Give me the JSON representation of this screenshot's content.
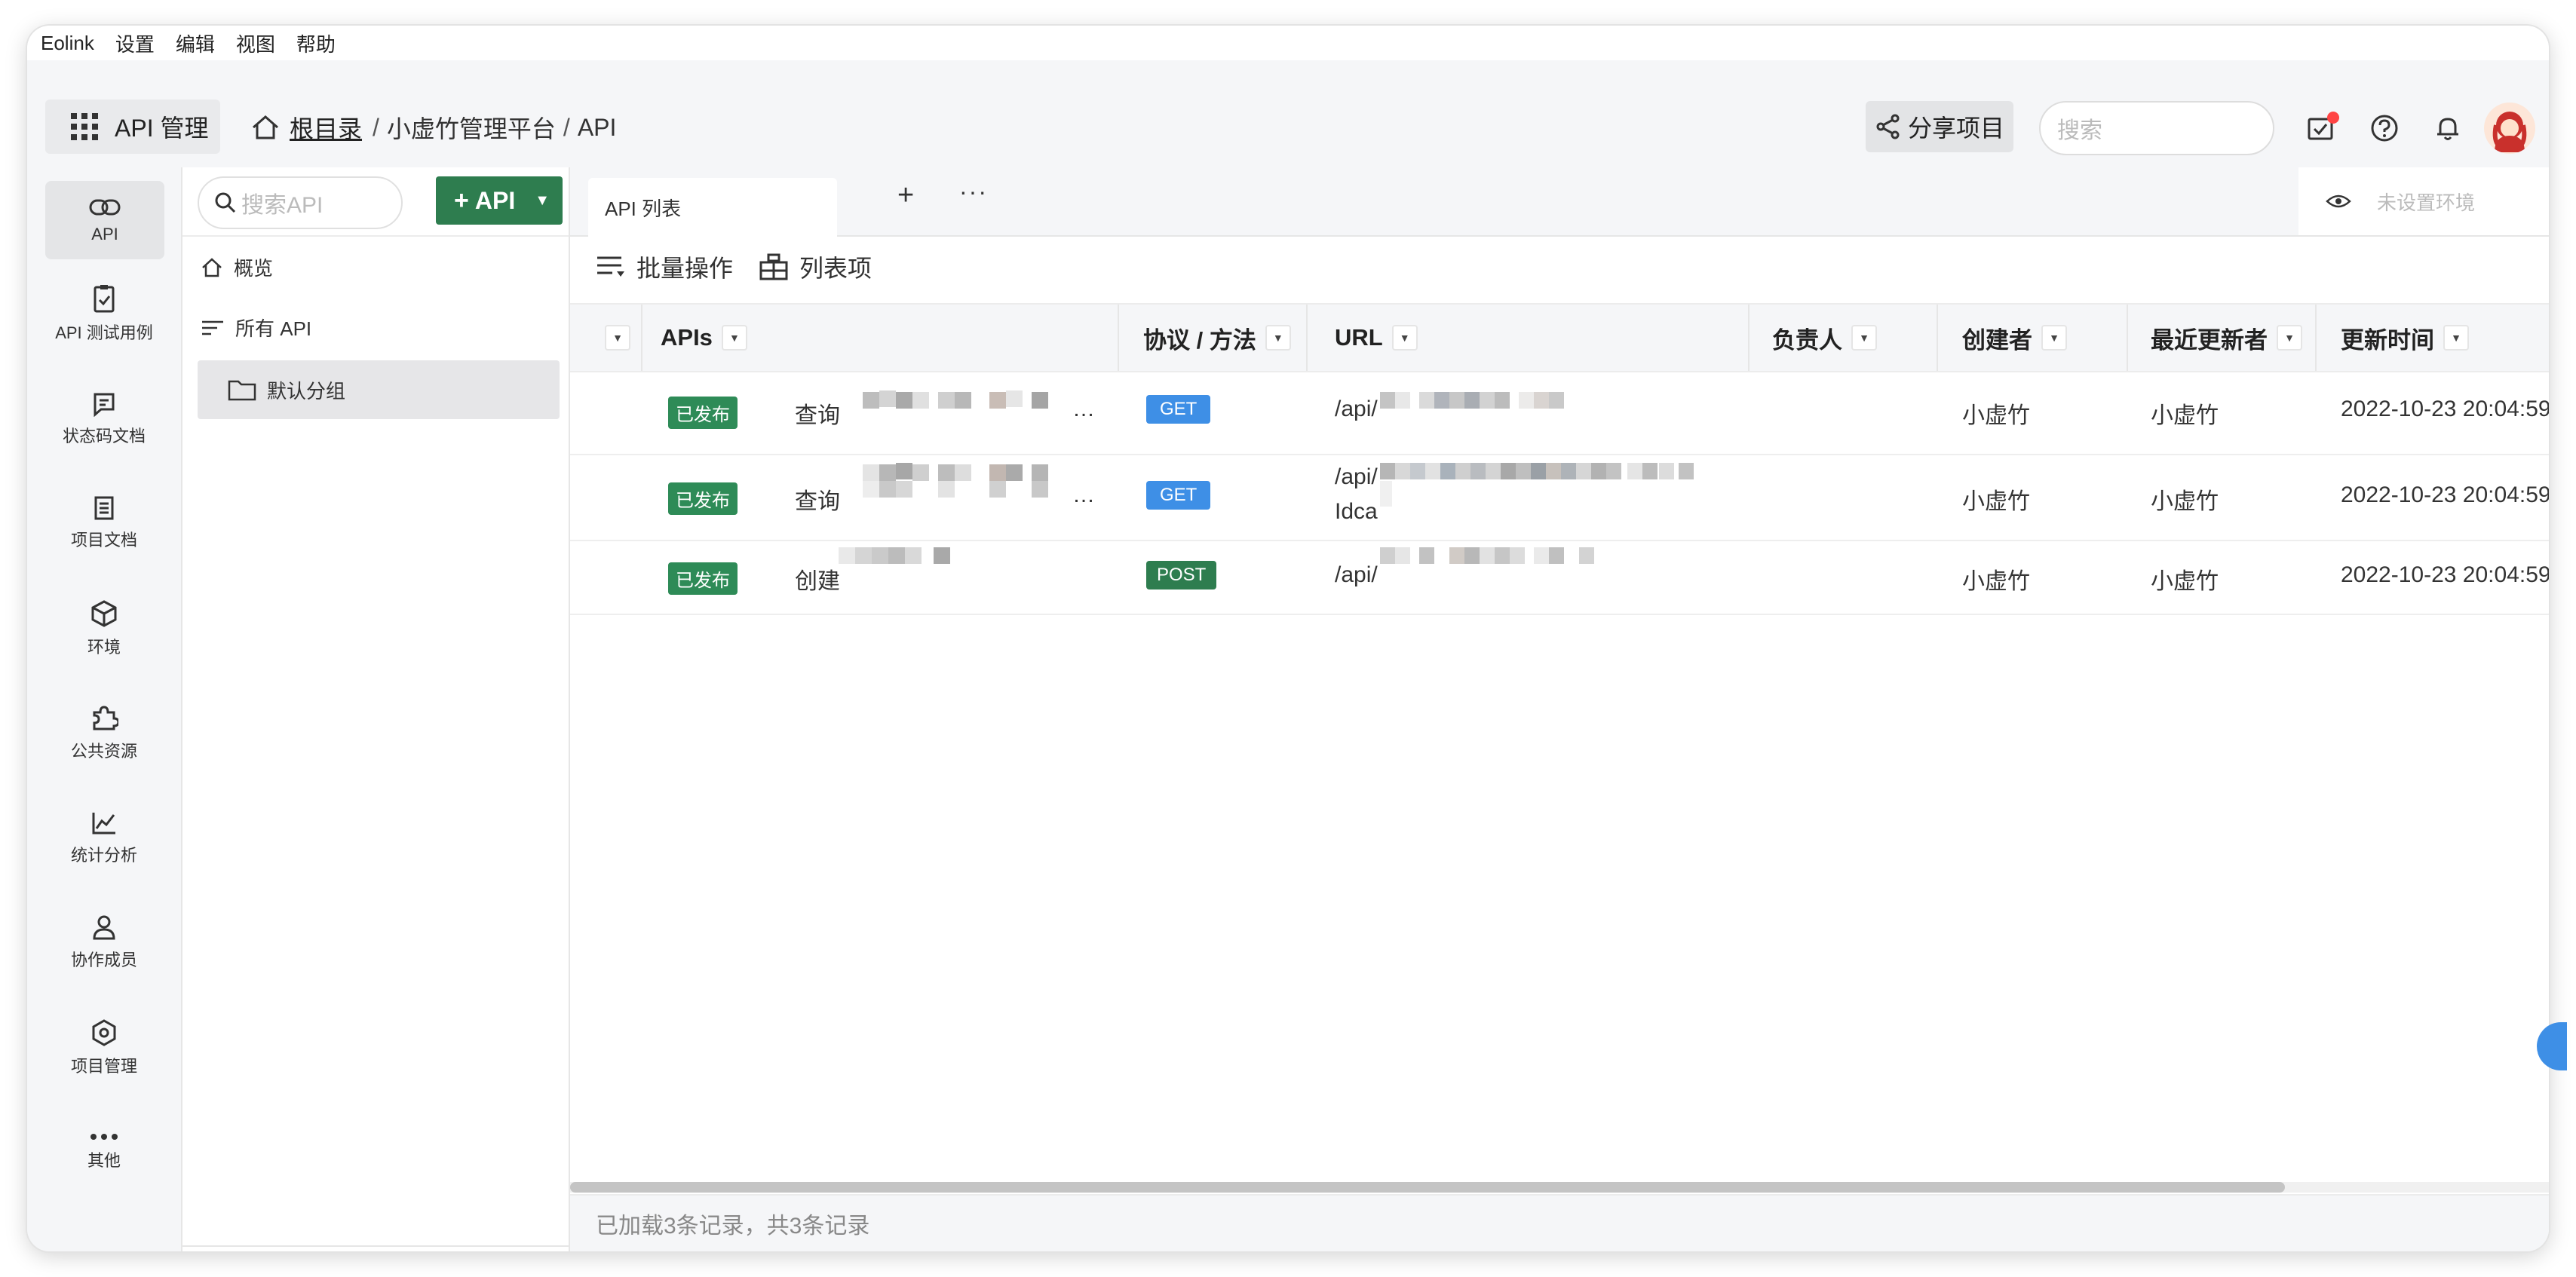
{
  "menubar": {
    "items": [
      "Eolink",
      "设置",
      "编辑",
      "视图",
      "帮助"
    ]
  },
  "header": {
    "app_label": "API 管理",
    "breadcrumb": {
      "root": "根目录",
      "sep1": "/",
      "project": "小虚竹管理平台",
      "sep2": "/",
      "current": "API"
    },
    "share_label": "分享项目",
    "search_placeholder": "搜索"
  },
  "rail": {
    "items": [
      {
        "label": "API",
        "icon": "link-icon"
      },
      {
        "label": "API 测试用例",
        "icon": "clipboard-check-icon"
      },
      {
        "label": "状态码文档",
        "icon": "status-code-icon"
      },
      {
        "label": "项目文档",
        "icon": "document-icon"
      },
      {
        "label": "环境",
        "icon": "cube-icon"
      },
      {
        "label": "公共资源",
        "icon": "puzzle-icon"
      },
      {
        "label": "统计分析",
        "icon": "chart-icon"
      },
      {
        "label": "协作成员",
        "icon": "user-icon"
      },
      {
        "label": "项目管理",
        "icon": "gear-icon"
      },
      {
        "label": "其他",
        "icon": "more-icon"
      }
    ]
  },
  "tree": {
    "search_placeholder": "搜索API",
    "add_label": "API",
    "items": [
      {
        "label": "概览",
        "icon": "home-icon"
      },
      {
        "label": "所有 API",
        "icon": "sort-lines-icon"
      },
      {
        "label": "默认分组",
        "icon": "folder-icon"
      }
    ]
  },
  "main": {
    "tabs": [
      {
        "label": "API 列表"
      }
    ],
    "env_placeholder": "未设置环境",
    "toolbar": {
      "batch_label": "批量操作",
      "columns_label": "列表项"
    },
    "columns": [
      "APIs",
      "协议 / 方法",
      "URL",
      "负责人",
      "创建者",
      "最近更新者",
      "更新时间"
    ],
    "rows": [
      {
        "status": "已发布",
        "name": "查询",
        "name_suffix": "…",
        "method": "GET",
        "url_line1": "/api/",
        "url_line2": "",
        "owner": "",
        "creator": "小虚竹",
        "updater": "小虚竹",
        "updated": "2022-10-23 20:04:59"
      },
      {
        "status": "已发布",
        "name": "查询",
        "name_suffix": "…",
        "method": "GET",
        "url_line1": "/api/",
        "url_line2": "Idca",
        "owner": "",
        "creator": "小虚竹",
        "updater": "小虚竹",
        "updated": "2022-10-23 20:04:59"
      },
      {
        "status": "已发布",
        "name": "创建",
        "name_suffix": "",
        "method": "POST",
        "url_line1": "/api/",
        "url_line2": "",
        "owner": "",
        "creator": "小虚竹",
        "updater": "小虚竹",
        "updated": "2022-10-23 20:04:59"
      }
    ],
    "footer_text": "已加载3条记录，共3条记录"
  },
  "colors": {
    "brand_green": "#2e7d4f",
    "get_blue": "#3e8fe6",
    "notification_red": "#f44"
  }
}
